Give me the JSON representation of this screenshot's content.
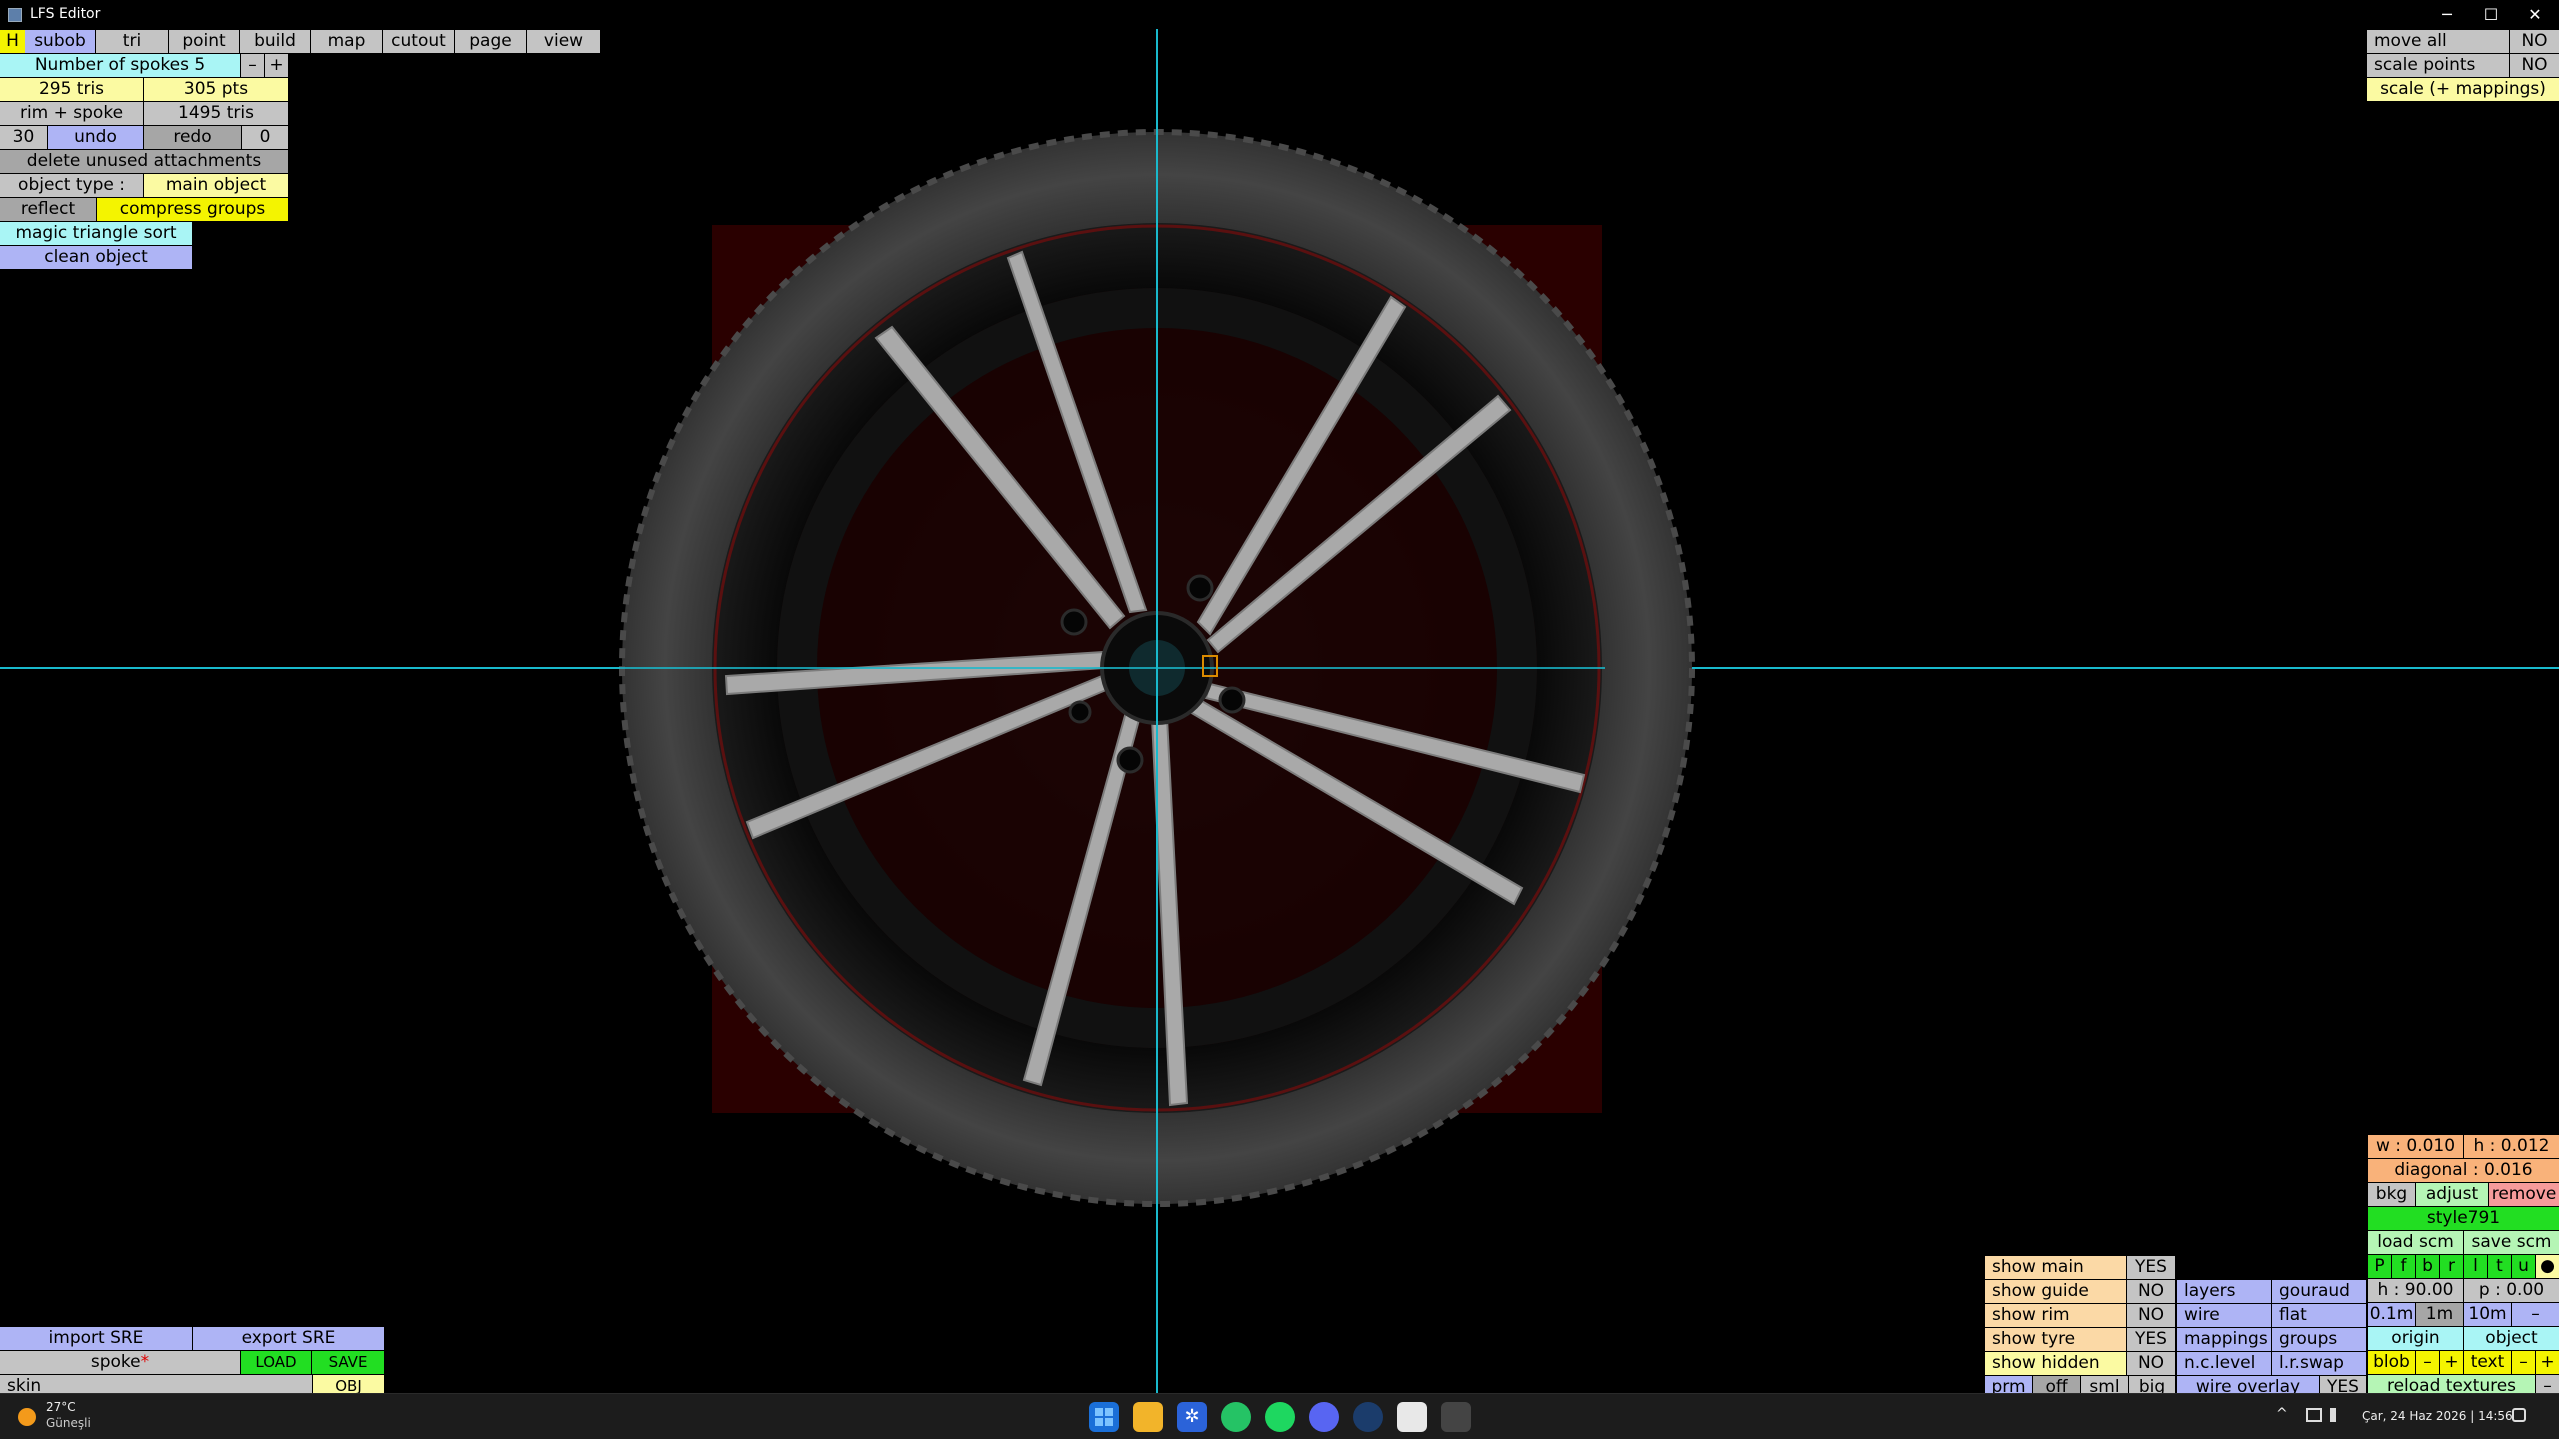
{
  "window": {
    "title": "LFS Editor",
    "minimize": "─",
    "maximize": "☐",
    "close": "✕"
  },
  "menu": {
    "h": "H",
    "subob": "subob",
    "tri": "tri",
    "point": "point",
    "build": "build",
    "map": "map",
    "cutout": "cutout",
    "page": "page",
    "view": "view"
  },
  "left_panel": {
    "spokes_label": "Number of spokes 5",
    "minus": "–",
    "plus": "+",
    "tris": "295 tris",
    "pts": "305 pts",
    "rim_spoke": "rim + spoke",
    "rim_tris": "1495 tris",
    "undo_count": "30",
    "undo": "undo",
    "redo": "redo",
    "redo_count": "0",
    "delete_unused": "delete unused attachments",
    "object_type_label": "object type :",
    "object_type_value": "main object",
    "reflect": "reflect",
    "compress_groups": "compress groups",
    "magic_sort": "magic triangle sort",
    "clean_object": "clean object"
  },
  "top_right": {
    "move_all": "move all",
    "move_all_val": "NO",
    "scale_points": "scale points",
    "scale_points_val": "NO",
    "scale_mappings": "scale (+ mappings)"
  },
  "bottom_left": {
    "import_sre": "import SRE",
    "export_sre": "export SRE",
    "spoke": "spoke",
    "asterisk": "*",
    "load": "LOAD",
    "save": "SAVE",
    "skin": "skin",
    "obj": "OBJ"
  },
  "bottom_right": {
    "show_main": "show main",
    "show_main_val": "YES",
    "show_guide": "show guide",
    "show_guide_val": "NO",
    "show_rim": "show rim",
    "show_rim_val": "NO",
    "show_tyre": "show tyre",
    "show_tyre_val": "YES",
    "show_hidden": "show hidden",
    "show_hidden_val": "NO",
    "prm": "prm",
    "off": "off",
    "sml": "sml",
    "big": "big",
    "layers": "layers",
    "gouraud": "gouraud",
    "wire": "wire",
    "flat": "flat",
    "mappings": "mappings",
    "groups": "groups",
    "nc_level": "n.c.level",
    "lr_swap": "l.r.swap",
    "wire_overlay": "wire overlay",
    "wire_overlay_val": "YES",
    "w": "w : 0.010",
    "h": "h : 0.012",
    "diagonal": "diagonal : 0.016",
    "bkg": "bkg",
    "adjust": "adjust",
    "remove": "remove",
    "style": "style791",
    "load_scm": "load scm",
    "save_scm": "save scm",
    "views": [
      "P",
      "f",
      "b",
      "r",
      "l",
      "t",
      "u",
      "●"
    ],
    "h_angle": "h : 90.00",
    "p_angle": "p : 0.00",
    "grid_01": "0.1m",
    "grid_1": "1m",
    "grid_10": "10m",
    "grid_minus": "–",
    "origin": "origin",
    "object": "object",
    "blob": "blob",
    "blob_minus": "–",
    "blob_plus": "+",
    "text": "text",
    "text_minus": "–",
    "text_plus": "+",
    "reload_textures": "reload textures",
    "rt_minus": "–"
  },
  "taskbar": {
    "temp": "27°C",
    "weather": "Güneşli",
    "date_time": "Çar, 24 Haz 2026 | 14:56",
    "chevron": "^"
  },
  "colors": {
    "crosshair": "#19b9cc",
    "backdrop": "#2a0000",
    "tyre": "#3a3a3a",
    "rim": "#0c0c0c",
    "spoke": "#a8a8a8"
  }
}
